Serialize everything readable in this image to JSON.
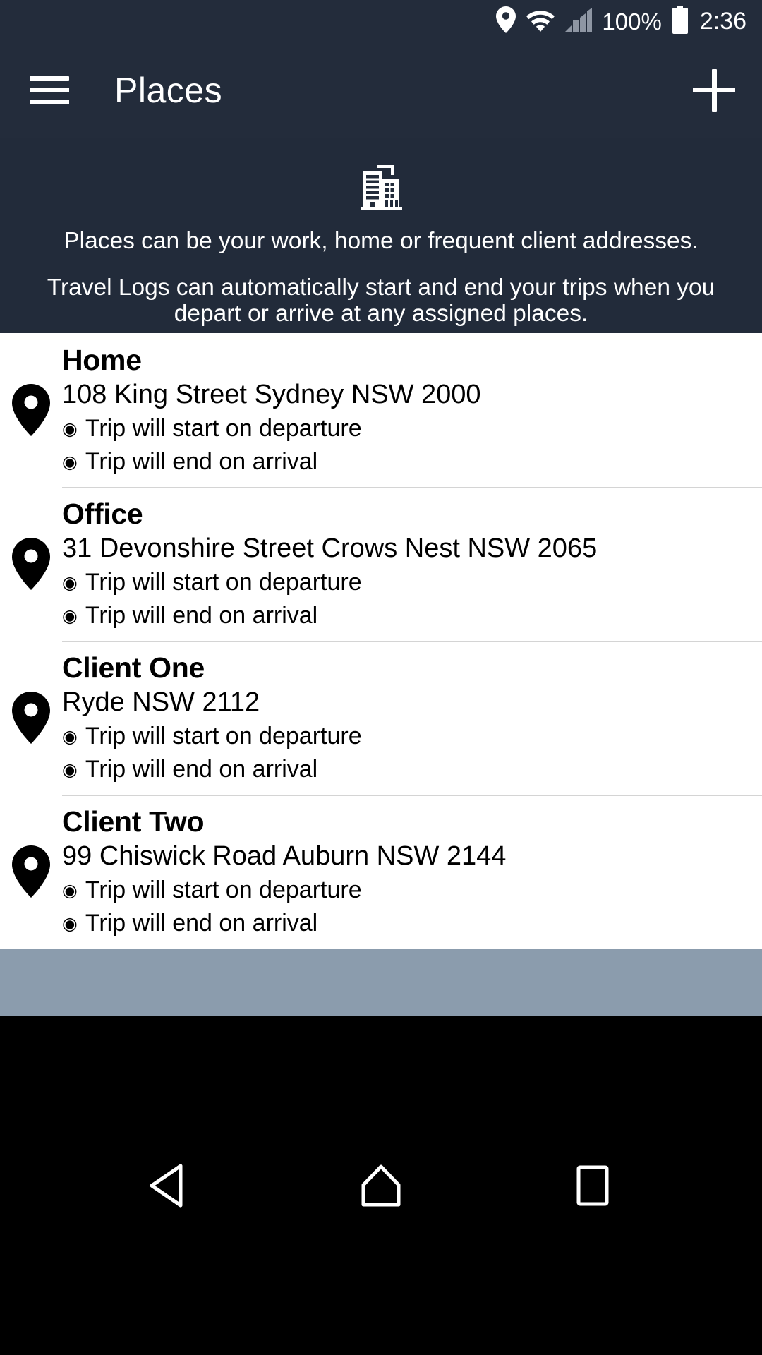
{
  "status_bar": {
    "battery_percent": "100%",
    "clock": "2:36",
    "icons": [
      "location-pin-icon",
      "wifi-icon",
      "signal-bars-icon",
      "battery-icon"
    ]
  },
  "toolbar": {
    "menu_icon": "hamburger-menu-icon",
    "title": "Places",
    "add_icon": "plus-icon"
  },
  "banner": {
    "icon": "office-building-icon",
    "paragraph1": "Places can be your work, home or frequent client addresses.",
    "paragraph2": "Travel Logs can automatically start and end your trips when you depart or arrive at any assigned places."
  },
  "places": [
    {
      "name": "Home",
      "address": "108 King Street Sydney NSW 2000",
      "rule_start": "Trip will start on departure",
      "rule_end": "Trip will end on arrival",
      "bullet": "◉",
      "pin_icon": "map-pin-icon"
    },
    {
      "name": "Office",
      "address": "31 Devonshire Street Crows Nest NSW 2065",
      "rule_start": "Trip will start on departure",
      "rule_end": "Trip will end on arrival",
      "bullet": "◉",
      "pin_icon": "map-pin-icon"
    },
    {
      "name": "Client One",
      "address": "Ryde NSW 2112",
      "rule_start": "Trip will start on departure",
      "rule_end": "Trip will end on arrival",
      "bullet": "◉",
      "pin_icon": "map-pin-icon"
    },
    {
      "name": "Client Two",
      "address": "99 Chiswick Road Auburn NSW 2144",
      "rule_start": "Trip will start on departure",
      "rule_end": "Trip will end on arrival",
      "bullet": "◉",
      "pin_icon": "map-pin-icon"
    }
  ],
  "nav_bar": {
    "back_icon": "back-triangle-icon",
    "home_icon": "home-pentagon-icon",
    "recents_icon": "recents-square-icon"
  },
  "colors": {
    "toolbar_bg": "#232c3b",
    "banner_bg": "#222b3a",
    "list_bg": "#ffffff",
    "grey_band": "#8b9cad",
    "nav_bg": "#000000",
    "text_light": "#ffffff",
    "text_dark": "#000000",
    "divider": "#d4d4d4"
  }
}
